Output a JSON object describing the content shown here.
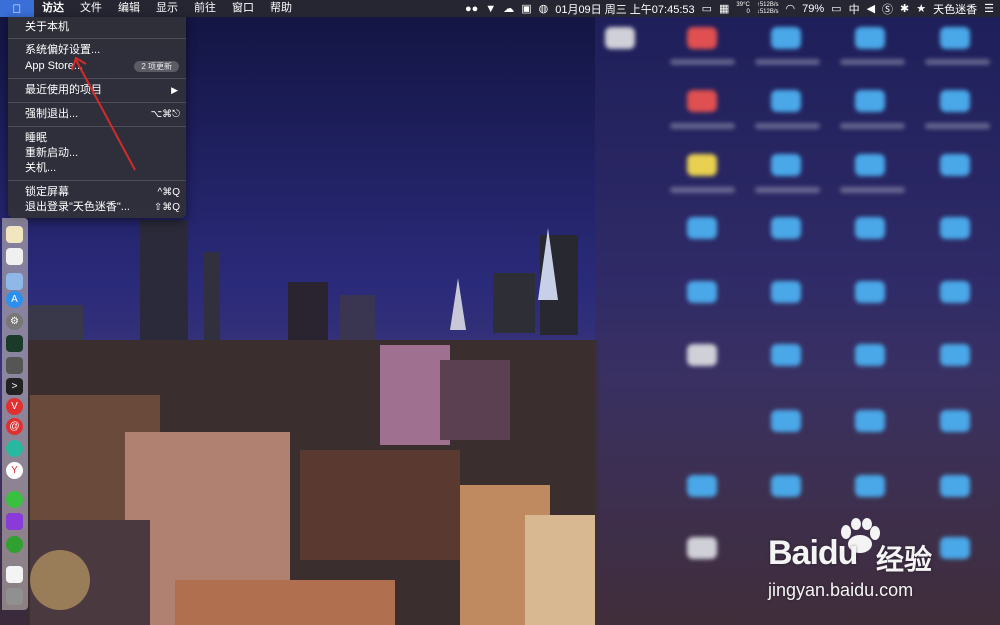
{
  "menubar": {
    "app_name": "访达",
    "items": [
      "文件",
      "编辑",
      "显示",
      "前往",
      "窗口",
      "帮助"
    ],
    "status": {
      "temp": "39°C",
      "temp_sub": "0",
      "net_up": "↑512B/s",
      "net_down": "↓512B/s",
      "clock": "01月09日 周三 上午07:45:53",
      "battery": "79%",
      "input_method": "中",
      "username": "天色迷香"
    }
  },
  "apple_menu": {
    "about": "关于本机",
    "system_prefs": "系统偏好设置...",
    "app_store": "App Store...",
    "app_store_badge": "2 项更新",
    "recent_items": "最近使用的项目",
    "force_quit": "强制退出...",
    "force_quit_shortcut": "⌥⌘⎋",
    "sleep": "睡眠",
    "restart": "重新启动...",
    "shutdown": "关机...",
    "lock_screen": "锁定屏幕",
    "lock_shortcut": "^⌘Q",
    "logout": "退出登录\"天色迷香\"...",
    "logout_shortcut": "⇧⌘Q"
  },
  "watermark": {
    "brand": "Baidu",
    "cn": "经验",
    "url": "jingyan.baidu.com"
  },
  "colors": {
    "menu_highlight": "#3a6fd8",
    "annotation": "#d42a2a"
  }
}
